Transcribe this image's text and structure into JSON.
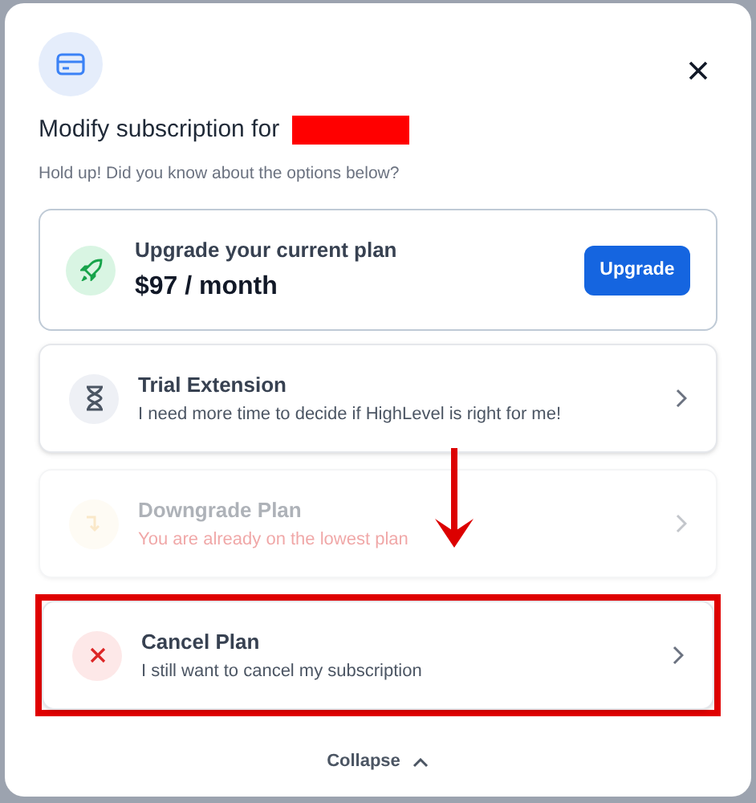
{
  "dialog": {
    "title": "Modify subscription for",
    "title_redacted": true,
    "subtitle": "Hold up! Did you know about the options below?"
  },
  "upgrade": {
    "title": "Upgrade your current plan",
    "price": "$97 / month",
    "button": "Upgrade"
  },
  "options": [
    {
      "kind": "trial",
      "title": "Trial Extension",
      "description": "I need more time to decide if HighLevel is right for me!",
      "disabled": false,
      "highlighted": false
    },
    {
      "kind": "downgrade",
      "title": "Downgrade Plan",
      "description": "You are already on the lowest plan",
      "disabled": true,
      "highlighted": false
    },
    {
      "kind": "cancel",
      "title": "Cancel Plan",
      "description": "I still want to cancel my subscription",
      "disabled": false,
      "highlighted": true
    }
  ],
  "annotation_arrow": true,
  "collapse": {
    "label": "Collapse",
    "expanded": true
  }
}
